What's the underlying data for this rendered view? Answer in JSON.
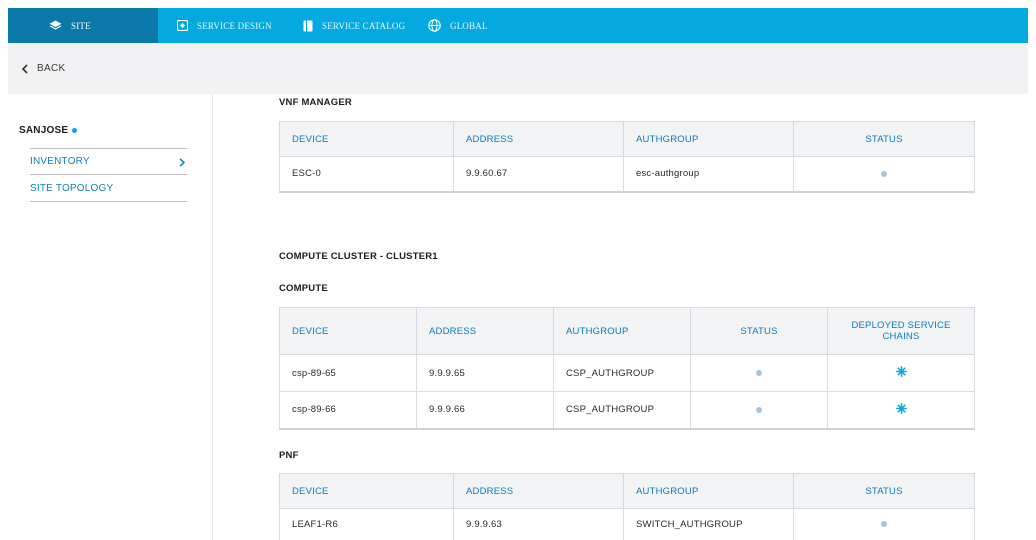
{
  "topnav": {
    "items": [
      {
        "label": "SITE",
        "icon": "layers-icon",
        "active": true
      },
      {
        "label": "SERVICE DESIGN",
        "icon": "service-design-icon",
        "active": false
      },
      {
        "label": "SERVICE CATALOG",
        "icon": "catalog-book-icon",
        "active": false
      },
      {
        "label": "GLOBAL",
        "icon": "globe-icon",
        "active": false
      }
    ]
  },
  "backbar": {
    "label": "BACK",
    "icon": "chevron-left-icon"
  },
  "sidebar": {
    "site": "SANJOSE",
    "items": [
      {
        "label": "INVENTORY",
        "icon": "chevron-right-icon"
      },
      {
        "label": "SITE TOPOLOGY"
      }
    ]
  },
  "vnf_manager": {
    "title": "VNF MANAGER",
    "columns": [
      "DEVICE",
      "ADDRESS",
      "AUTHGROUP",
      "STATUS"
    ],
    "rows": [
      {
        "device": "ESC-0",
        "address": "9.9.60.67",
        "authgroup": "esc-authgroup",
        "status": "status-ok-icon"
      }
    ]
  },
  "cluster": {
    "title": "COMPUTE CLUSTER - CLUSTER1"
  },
  "compute": {
    "title": "COMPUTE",
    "columns": [
      "DEVICE",
      "ADDRESS",
      "AUTHGROUP",
      "STATUS",
      "DEPLOYED SERVICE CHAINS"
    ],
    "rows": [
      {
        "device": "csp-89-65",
        "address": "9.9.9.65",
        "authgroup": "CSP_AUTHGROUP",
        "status": "status-ok-icon",
        "chains": "service-chain-icon"
      },
      {
        "device": "csp-89-66",
        "address": "9.9.9.66",
        "authgroup": "CSP_AUTHGROUP",
        "status": "status-ok-icon",
        "chains": "service-chain-icon"
      }
    ]
  },
  "pnf": {
    "title": "PNF",
    "columns": [
      "DEVICE",
      "ADDRESS",
      "AUTHGROUP",
      "STATUS"
    ],
    "rows": [
      {
        "device": "LEAF1-R6",
        "address": "9.9.9.63",
        "authgroup": "SWITCH_AUTHGROUP",
        "status": "status-ok-icon"
      }
    ]
  },
  "colors": {
    "accent": "#04a9e0",
    "active_tab": "#0b78aa",
    "link": "#0d80c0",
    "header_bg": "#f2f3f5"
  }
}
